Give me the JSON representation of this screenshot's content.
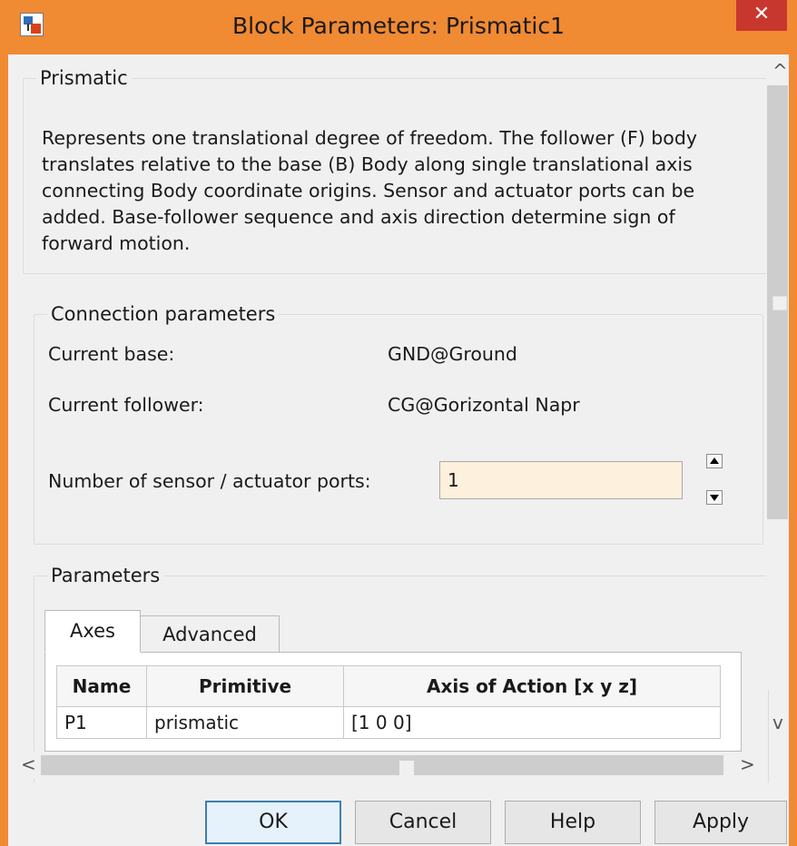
{
  "window": {
    "title": "Block Parameters: Prismatic1",
    "close_glyph": "✕"
  },
  "description_group": {
    "legend": "Prismatic",
    "text": "Represents one translational degree of freedom. The follower (F) body translates relative to the base (B) Body along single translational axis connecting Body coordinate origins. Sensor and actuator ports can be added. Base-follower sequence and axis direction determine sign of forward motion."
  },
  "connection": {
    "legend": "Connection parameters",
    "base_label": "Current base:",
    "base_value": "GND@Ground",
    "follower_label": "Current follower:",
    "follower_value": "CG@Gorizontal Napr",
    "ports_label": "Number of sensor / actuator ports:",
    "ports_value": "1"
  },
  "parameters": {
    "legend": "Parameters",
    "tabs": [
      {
        "label": "Axes",
        "active": true
      },
      {
        "label": "Advanced",
        "active": false
      }
    ],
    "table": {
      "headers": [
        "Name",
        "Primitive",
        "Axis of Action [x y z]"
      ],
      "rows": [
        [
          "P1",
          "prismatic",
          "[1 0 0]"
        ]
      ]
    }
  },
  "scrollbars": {
    "up": "^",
    "down": "v",
    "left": "<",
    "right": ">"
  },
  "buttons": {
    "ok": "OK",
    "cancel": "Cancel",
    "help": "Help",
    "apply": "Apply"
  },
  "colors": {
    "titlebar": "#f08a33",
    "close": "#c7372d",
    "input_bg": "#fdf0dd"
  }
}
